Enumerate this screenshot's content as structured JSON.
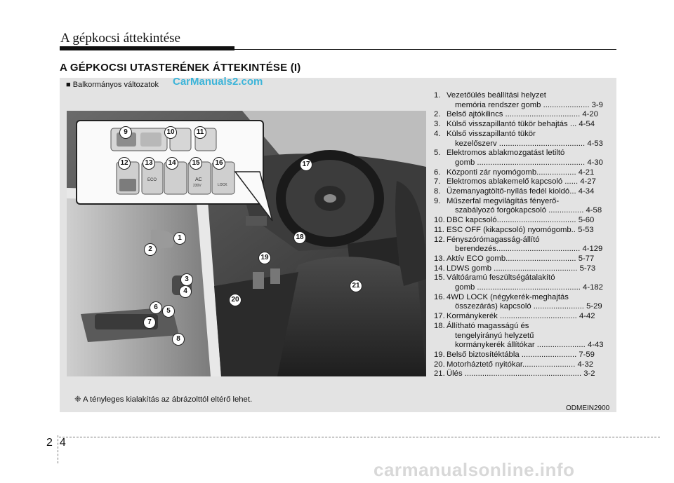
{
  "header": {
    "title": "A gépkocsi áttekintése"
  },
  "section_title": "A GÉPKOCSI UTASTERÉNEK ÁTTEKINTÉSE (I)",
  "variant_label": "■ Balkormányos változatok",
  "watermark_top": "CarManuals2.com",
  "watermark_bottom": "carmanualsonline.info",
  "items": [
    {
      "num": "1.",
      "lines": [
        "Vezetőülés beállítási helyzet",
        "memória rendszer gomb ..................... 3-9"
      ]
    },
    {
      "num": "2.",
      "lines": [
        "Belső ajtókilincs .................................. 4-20"
      ]
    },
    {
      "num": "3.",
      "lines": [
        "Külső visszapillantó tükör behajtás ... 4-54"
      ]
    },
    {
      "num": "4.",
      "lines": [
        "Külső visszapillantó tükör",
        "kezelőszerv ....................................... 4-53"
      ]
    },
    {
      "num": "5.",
      "lines": [
        "Elektromos ablakmozgatást letiltó",
        "gomb ................................................. 4-30"
      ]
    },
    {
      "num": "6.",
      "lines": [
        "Központi zár nyomógomb.................. 4-21"
      ]
    },
    {
      "num": "7.",
      "lines": [
        "Elektromos ablakemelő kapcsoló ...... 4-27"
      ]
    },
    {
      "num": "8.",
      "lines": [
        "Üzemanyagtöltő-nyílás fedél kioldó... 4-34"
      ]
    },
    {
      "num": "9.",
      "lines": [
        "Műszerfal megvilágítás fényerő-",
        "szabályozó forgókapcsoló ................ 4-58"
      ]
    },
    {
      "num": "10.",
      "lines": [
        "DBC kapcsoló.................................... 5-60"
      ]
    },
    {
      "num": "11.",
      "lines": [
        "ESC OFF (kikapcsoló) nyomógomb.. 5-53"
      ]
    },
    {
      "num": "12.",
      "lines": [
        "Fényszórómagasság-állító",
        "berendezés...................................... 4-129"
      ]
    },
    {
      "num": "13.",
      "lines": [
        "Aktív ECO gomb................................ 5-77"
      ]
    },
    {
      "num": "14.",
      "lines": [
        "LDWS gomb ...................................... 5-73"
      ]
    },
    {
      "num": "15.",
      "lines": [
        "Váltóáramú feszültségátalakító",
        "gomb ............................................... 4-182"
      ]
    },
    {
      "num": "16.",
      "lines": [
        "4WD LOCK (négykerék-meghajtás",
        "összezárás) kapcsoló ....................... 5-29"
      ]
    },
    {
      "num": "17.",
      "lines": [
        "Kormánykerék ................................... 4-42"
      ]
    },
    {
      "num": "18.",
      "lines": [
        "Állítható magasságú és",
        "tengelyirányú helyzetű",
        "kormánykerék állítókar ...................... 4-43"
      ]
    },
    {
      "num": "19.",
      "lines": [
        "Belső biztosítéktábla ......................... 7-59"
      ]
    },
    {
      "num": "20.",
      "lines": [
        "Motorháztető nyitókar........................ 4-32"
      ]
    },
    {
      "num": "21.",
      "lines": [
        "Ülés ..................................................... 3-2"
      ]
    }
  ],
  "callouts": [
    "1",
    "2",
    "3",
    "4",
    "5",
    "6",
    "7",
    "8",
    "9",
    "10",
    "11",
    "12",
    "13",
    "14",
    "15",
    "16",
    "17",
    "18",
    "19",
    "20",
    "21"
  ],
  "inset_labels": {
    "eco": "ECO",
    "ac": "AC",
    "ac_sub": "230V",
    "lock": "LOCK"
  },
  "note": "❈ A tényleges kialakítás az ábrázolttól eltérő lehet.",
  "image_code": "ODMEIN2900",
  "page": {
    "left": "2",
    "right": "4"
  }
}
